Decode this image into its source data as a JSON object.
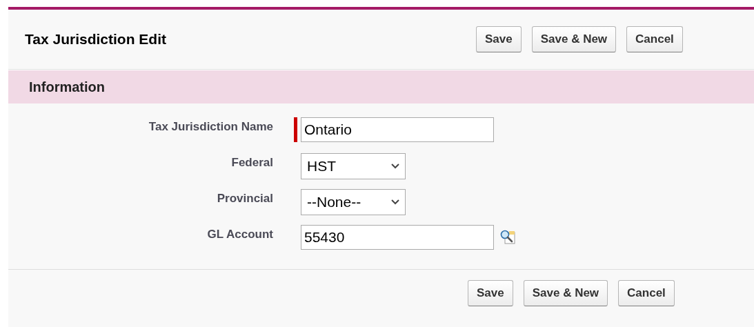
{
  "title": "Tax Jurisdiction Edit",
  "top_buttons": [
    "Save",
    "Save & New",
    "Cancel"
  ],
  "section": {
    "title": "Information"
  },
  "fields": [
    {
      "label": "Tax Jurisdiction Name",
      "kind": "text",
      "value": "Ontario",
      "required": true
    },
    {
      "label": "Federal",
      "kind": "select",
      "value": "HST",
      "required": false
    },
    {
      "label": "Provincial",
      "kind": "select",
      "value": "--None--",
      "required": false
    },
    {
      "label": "GL Account",
      "kind": "lookup",
      "value": "55430",
      "required": false
    }
  ],
  "bottom_buttons": [
    "Save",
    "Save & New",
    "Cancel"
  ]
}
